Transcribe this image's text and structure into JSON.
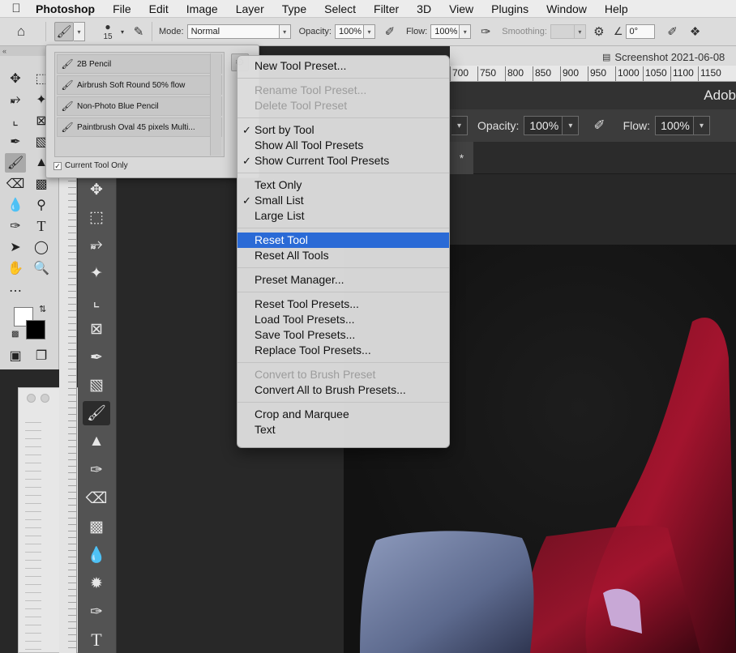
{
  "menubar": {
    "app_name": "Photoshop",
    "items": [
      "File",
      "Edit",
      "Image",
      "Layer",
      "Type",
      "Select",
      "Filter",
      "3D",
      "View",
      "Plugins",
      "Window",
      "Help"
    ]
  },
  "options_bar": {
    "brush_size": "15",
    "mode_label": "Mode:",
    "mode_value": "Normal",
    "opacity_label": "Opacity:",
    "opacity_value": "100%",
    "flow_label": "Flow:",
    "flow_value": "100%",
    "smoothing_label": "Smoothing:",
    "smoothing_value": "",
    "angle_value": "0°"
  },
  "tool_presets": {
    "items": [
      {
        "label": "2B Pencil"
      },
      {
        "label": "Airbrush Soft Round 50% flow"
      },
      {
        "label": "Non-Photo Blue Pencil"
      },
      {
        "label": "Paintbrush Oval 45 pixels Multi..."
      }
    ],
    "current_tool_only_label": "Current Tool Only",
    "current_tool_only_checked": "✓"
  },
  "context_menu": {
    "groups": [
      [
        {
          "label": "New Tool Preset...",
          "checked": "",
          "enabled": true
        }
      ],
      [
        {
          "label": "Rename Tool Preset...",
          "checked": "",
          "enabled": false
        },
        {
          "label": "Delete Tool Preset",
          "checked": "",
          "enabled": false
        }
      ],
      [
        {
          "label": "Sort by Tool",
          "checked": "✓",
          "enabled": true
        },
        {
          "label": "Show All Tool Presets",
          "checked": "",
          "enabled": true
        },
        {
          "label": "Show Current Tool Presets",
          "checked": "✓",
          "enabled": true
        }
      ],
      [
        {
          "label": "Text Only",
          "checked": "",
          "enabled": true
        },
        {
          "label": "Small List",
          "checked": "✓",
          "enabled": true
        },
        {
          "label": "Large List",
          "checked": "",
          "enabled": true
        }
      ],
      [
        {
          "label": "Reset Tool",
          "checked": "",
          "enabled": true,
          "highlighted": true
        },
        {
          "label": "Reset All Tools",
          "checked": "",
          "enabled": true
        }
      ],
      [
        {
          "label": "Preset Manager...",
          "checked": "",
          "enabled": true
        }
      ],
      [
        {
          "label": "Reset Tool Presets...",
          "checked": "",
          "enabled": true
        },
        {
          "label": "Load Tool Presets...",
          "checked": "",
          "enabled": true
        },
        {
          "label": "Save Tool Presets...",
          "checked": "",
          "enabled": true
        },
        {
          "label": "Replace Tool Presets...",
          "checked": "",
          "enabled": true
        }
      ],
      [
        {
          "label": "Convert to Brush Preset",
          "checked": "",
          "enabled": false
        },
        {
          "label": "Convert All to Brush Presets...",
          "checked": "",
          "enabled": true
        }
      ],
      [
        {
          "label": "Crop and Marquee",
          "checked": "",
          "enabled": true
        },
        {
          "label": "Text",
          "checked": "",
          "enabled": true
        }
      ]
    ]
  },
  "document": {
    "tab_title": "Screenshot 2021-06-08",
    "ruler_ticks": [
      "700",
      "750",
      "800",
      "850",
      "900",
      "950",
      "1000",
      "1050",
      "1100",
      "1150"
    ],
    "app_title": "Adob",
    "opacity_label": "Opacity:",
    "opacity_value": "100%",
    "flow_label": "Flow:",
    "flow_value": "100%",
    "tab_marker": "*"
  }
}
